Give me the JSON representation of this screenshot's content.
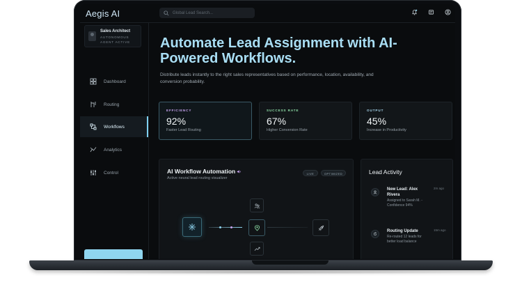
{
  "app": {
    "brand": "Aegis AI"
  },
  "search": {
    "placeholder": "Global Lead Search..."
  },
  "profile": {
    "name": "Sales Architect",
    "status": "AUTONOMOUS AGENT ACTIVE"
  },
  "sidebar": {
    "items": [
      {
        "label": "Dashboard",
        "icon": "grid-icon",
        "active": false
      },
      {
        "label": "Routing",
        "icon": "route-icon",
        "active": false
      },
      {
        "label": "Workflows",
        "icon": "workflow-icon",
        "active": true
      },
      {
        "label": "Analytics",
        "icon": "analytics-icon",
        "active": false
      },
      {
        "label": "Control",
        "icon": "control-icon",
        "active": false
      }
    ]
  },
  "hero": {
    "title": "Automate Lead Assignment with AI-Powered Workflows.",
    "description": "Distribute leads instantly to the right sales representatives based on performance, location, availability, and conversion probability."
  },
  "stats": [
    {
      "label": "EFFICIENCY",
      "value": "92%",
      "caption": "Faster Lead Routing",
      "color": "#c8a4f0"
    },
    {
      "label": "SUCCESS RATE",
      "value": "67%",
      "caption": "Higher Conversion Rate",
      "color": "#8fe0a8"
    },
    {
      "label": "OUTPUT",
      "value": "45%",
      "caption": "Increase in Productivity",
      "color": "#a8d8ef"
    }
  ],
  "workflow": {
    "title": "AI Workflow Automation",
    "subtitle": "Active neural lead routing visualizer",
    "badges": [
      "LIVE",
      "OPTIMIZED"
    ]
  },
  "activity": {
    "title": "Lead Activity",
    "items": [
      {
        "title": "New Lead: Alex Rivera",
        "detail": "Assigned to Sarah M. - Confidence 94%",
        "time": "2m ago",
        "icon": "user-icon"
      },
      {
        "title": "Routing Update",
        "detail": "Re-routed 12 leads for better load balance",
        "time": "15m ago",
        "icon": "refresh-icon"
      }
    ]
  },
  "colors": {
    "accent": "#7fd0f0",
    "headline": "#a9def4",
    "background": "#0a0c0e"
  }
}
